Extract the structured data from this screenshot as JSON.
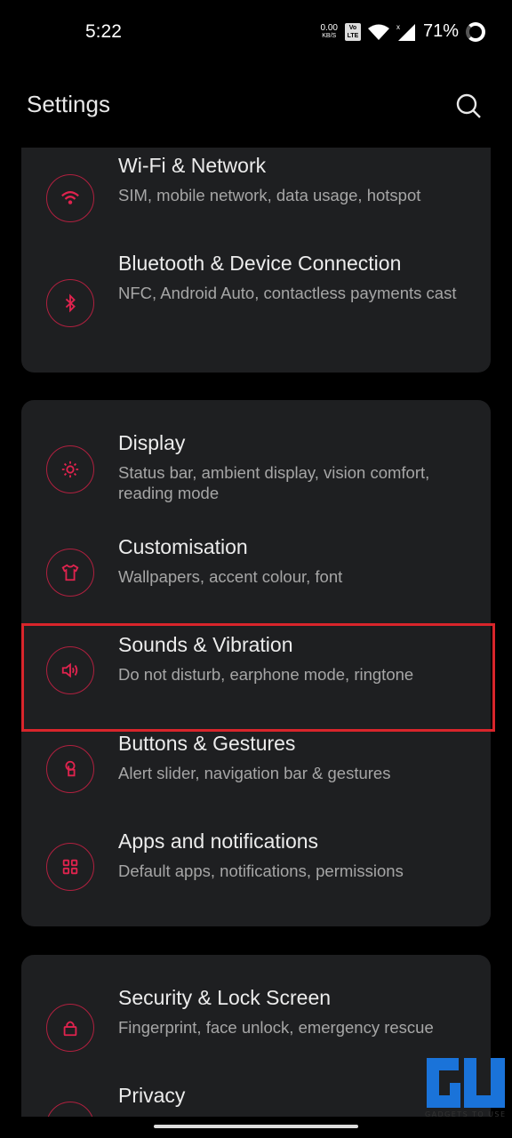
{
  "status": {
    "time": "5:22",
    "speed": "0.00",
    "speed_unit": "KB/S",
    "volte": "Vo LTE",
    "battery": "71%"
  },
  "appbar": {
    "title": "Settings",
    "search_icon": "search-icon"
  },
  "accent": "#e0234e",
  "highlight_color": "#d9252b",
  "groups": [
    {
      "items": [
        {
          "title": "Wi-Fi & Network",
          "subtitle": "SIM, mobile network, data usage, hotspot",
          "icon": "wifi-icon"
        },
        {
          "title": "Bluetooth & Device Connection",
          "subtitle": "NFC, Android Auto, contactless payments cast",
          "icon": "bluetooth-icon"
        }
      ]
    },
    {
      "items": [
        {
          "title": "Display",
          "subtitle": "Status bar, ambient display, vision comfort, reading mode",
          "icon": "brightness-icon"
        },
        {
          "title": "Customisation",
          "subtitle": "Wallpapers, accent colour, font",
          "icon": "tshirt-icon"
        },
        {
          "title": "Sounds & Vibration",
          "subtitle": "Do not disturb, earphone mode, ringtone",
          "icon": "speaker-icon",
          "highlighted": true
        },
        {
          "title": "Buttons & Gestures",
          "subtitle": "Alert slider, navigation bar & gestures",
          "icon": "gesture-icon"
        },
        {
          "title": "Apps and notifications",
          "subtitle": "Default apps, notifications, permissions",
          "icon": "apps-grid-icon"
        }
      ]
    },
    {
      "items": [
        {
          "title": "Security & Lock Screen",
          "subtitle": "Fingerprint, face unlock, emergency rescue",
          "icon": "lock-icon"
        },
        {
          "title": "Privacy",
          "subtitle": "",
          "icon": "privacy-shield-icon"
        }
      ]
    }
  ],
  "watermark": "GADGETS TO USE"
}
